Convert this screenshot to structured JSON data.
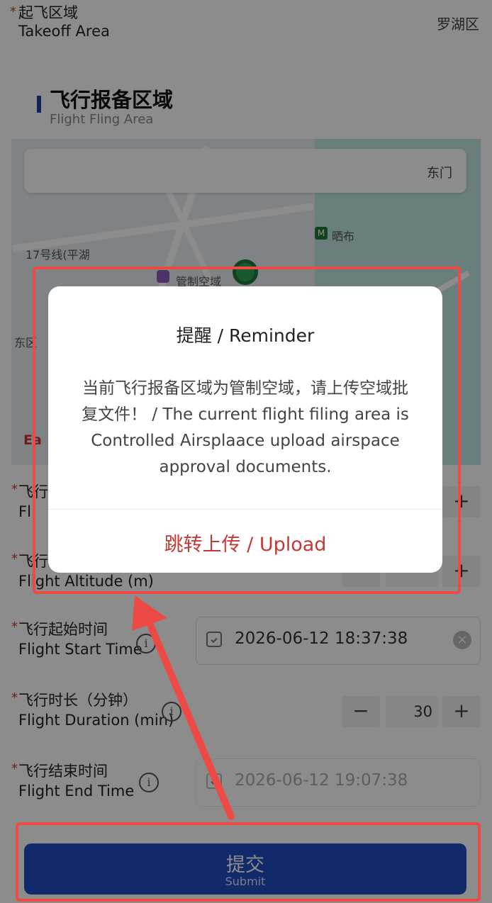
{
  "takeoff": {
    "label_zh": "起飞区域",
    "label_en": "Takeoff Area",
    "value": "罗湖区"
  },
  "section": {
    "title": "飞行报备区域",
    "subtitle": "Flight Fling Area"
  },
  "map": {
    "search_value": "东门",
    "labels": [
      "晒布",
      "17号线(平湖",
      "管制空域",
      "东区"
    ],
    "warning": "Ea"
  },
  "fields": {
    "radius": {
      "label_zh": "飞行",
      "label_en": "Fl"
    },
    "altitude": {
      "label_zh": "飞行",
      "label_en": "Flight Altitude (m)"
    },
    "start": {
      "label_zh": "飞行起始时间",
      "label_en": "Flight Start Time",
      "value": "2026-06-12 18:37:38"
    },
    "duration": {
      "label_zh": "飞行时长（分钟）",
      "label_en": "Flight Duration (min)",
      "value": "30",
      "minus": "−",
      "plus": "+"
    },
    "end": {
      "label_zh": "飞行结束时间",
      "label_en": "Flight End Time",
      "value": "2026-06-12 19:07:38"
    }
  },
  "submit": {
    "label_zh": "提交",
    "label_en": "Submit"
  },
  "dialog": {
    "title": "提醒 / Reminder",
    "body": "当前飞行报备区域为管制空域，请上传空域批复文件！ / The current flight filing area is Controlled Airsplaace upload airspace approval documents.",
    "action": "跳转上传 / Upload"
  },
  "icons": [
    "calendar-icon",
    "clear-icon",
    "info-icon",
    "metro-icon",
    "poi-icon",
    "location-pin-icon"
  ],
  "colors": {
    "primary": "#1f4fc1",
    "required": "#d0342c",
    "annotation": "#ee4a45",
    "dialog_action": "#c33a35"
  }
}
